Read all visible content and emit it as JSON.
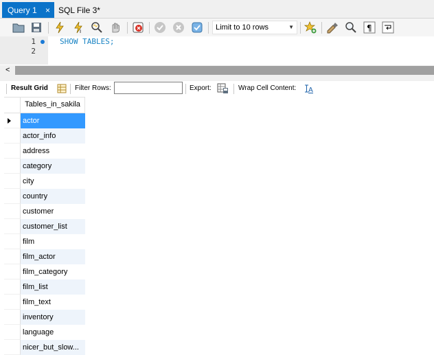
{
  "tabs": [
    {
      "label": "Query 1",
      "close": "×"
    },
    {
      "label": "SQL File 3*"
    }
  ],
  "toolbar": {
    "limit_value": "Limit to 10 rows",
    "icons": [
      "open-folder-icon",
      "save-icon",
      "execute-icon",
      "execute-current-icon",
      "explain-icon",
      "stop-icon",
      "toggle-error-icon",
      "commit-icon",
      "rollback-icon",
      "autocommit-icon",
      "add-snippet-icon",
      "beautify-icon",
      "find-icon",
      "invisible-chars-icon",
      "word-wrap-icon"
    ]
  },
  "editor": {
    "lines": [
      "1",
      "2"
    ],
    "code": "SHOW TABLES;"
  },
  "scrollbar": {
    "left_arrow": "<"
  },
  "result_toolbar": {
    "result_grid": "Result Grid",
    "filter_rows": "Filter Rows:",
    "filter_value": "",
    "export": "Export:",
    "wrap_cell": "Wrap Cell Content:"
  },
  "grid": {
    "column": "Tables_in_sakila",
    "rows": [
      "actor",
      "actor_info",
      "address",
      "category",
      "city",
      "country",
      "customer",
      "customer_list",
      "film",
      "film_actor",
      "film_category",
      "film_list",
      "film_text",
      "inventory",
      "language",
      "nicer_but_slow..."
    ],
    "selected_index": 0
  },
  "colors": {
    "accent": "#0b73c9",
    "selection": "#3399ff",
    "keyword": "#1a84c4"
  }
}
